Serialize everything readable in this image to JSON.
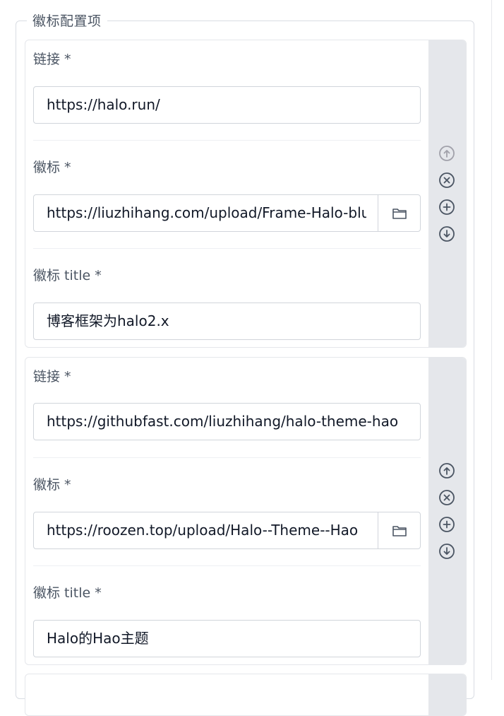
{
  "section": {
    "legend": "徽标配置项"
  },
  "items": [
    {
      "link_label": "链接",
      "link_value": "https://halo.run/",
      "icon_label": "徽标",
      "icon_value": "https://liuzhihang.com/upload/Frame-Halo-blue",
      "title_label": "徽标 title",
      "title_value": "博客框架为halo2.x",
      "required_mark": "*",
      "controls": [
        "arrow-up-circle-icon",
        "close-circle-icon",
        "plus-circle-icon",
        "arrow-down-circle-icon"
      ],
      "move_up_disabled": true
    },
    {
      "link_label": "链接",
      "link_value": "https://githubfast.com/liuzhihang/halo-theme-hao",
      "icon_label": "徽标",
      "icon_value": "https://roozen.top/upload/Halo--Theme--Hao",
      "title_label": "徽标 title",
      "title_value": "Halo的Hao主题",
      "required_mark": "*",
      "controls": [
        "arrow-up-circle-icon",
        "close-circle-icon",
        "plus-circle-icon",
        "arrow-down-circle-icon"
      ],
      "move_up_disabled": false
    }
  ],
  "colors": {
    "side_panel": "#e5e7eb",
    "icon_active": "#4b5563",
    "icon_disabled": "#a1a1aa",
    "border": "#d1d5db"
  }
}
